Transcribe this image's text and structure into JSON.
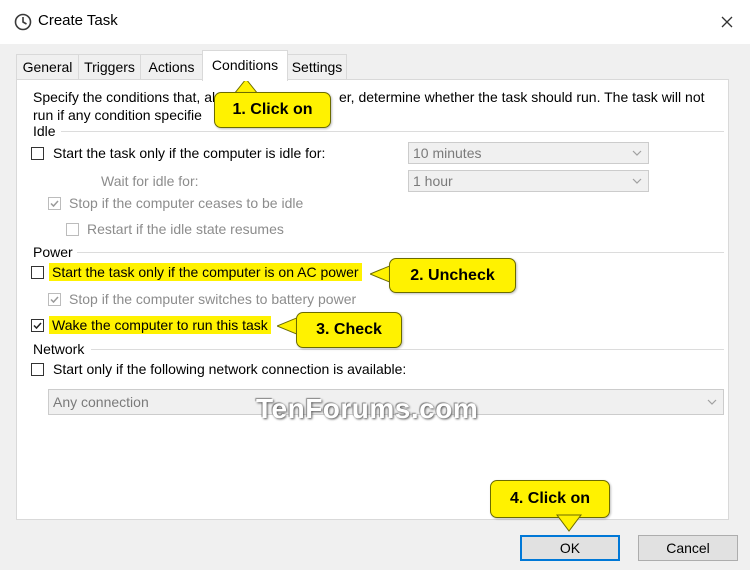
{
  "window": {
    "title": "Create Task",
    "icon": "task-scheduler-icon"
  },
  "tabs": [
    {
      "label": "General",
      "active": false
    },
    {
      "label": "Triggers",
      "active": false
    },
    {
      "label": "Actions",
      "active": false
    },
    {
      "label": "Conditions",
      "active": true
    },
    {
      "label": "Settings",
      "active": false
    }
  ],
  "intro": {
    "line1_a": "Specify the conditions that, al",
    "line1_b": "er, determine whether the task should run.  The task will not",
    "line2": "run  if any condition specifie"
  },
  "idle": {
    "header": "Idle",
    "start_only_idle": {
      "label": "Start the task only if the computer is idle for:",
      "checked": false
    },
    "idle_duration": "10 minutes",
    "wait_label": "Wait for idle for:",
    "wait_duration": "1 hour",
    "stop_if_ceases": {
      "label": "Stop if the computer ceases to be idle",
      "checked": true
    },
    "restart_if_resumes": {
      "label": "Restart if the idle state resumes",
      "checked": false
    }
  },
  "power": {
    "header": "Power",
    "ac_power_only": {
      "label": "Start the task only if the computer is on AC power",
      "checked": false
    },
    "stop_on_battery": {
      "label": "Stop if the computer switches to battery power",
      "checked": true
    },
    "wake_to_run": {
      "label": "Wake the computer to run this task",
      "checked": true
    }
  },
  "network": {
    "header": "Network",
    "start_only_network": {
      "label": "Start only if the following network connection is available:",
      "checked": false
    },
    "connection": "Any connection"
  },
  "callouts": {
    "step1": "1. Click on",
    "step2": "2. Uncheck",
    "step3": "3. Check",
    "step4": "4. Click on"
  },
  "watermark": "TenForums.com",
  "buttons": {
    "ok": "OK",
    "cancel": "Cancel"
  },
  "colors": {
    "highlight": "#fff200",
    "accent": "#0078d7",
    "disabled_text": "#8c8c8c"
  }
}
